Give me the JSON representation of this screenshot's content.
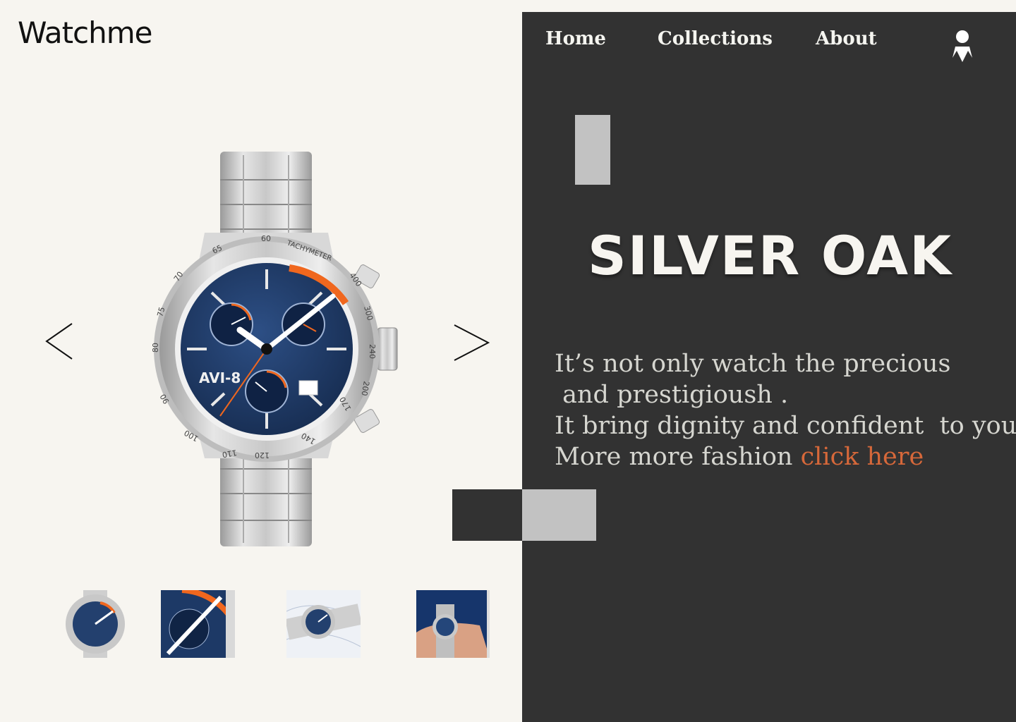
{
  "brand": {
    "logo_text": "Watchme"
  },
  "nav": {
    "items": [
      {
        "label": "Home"
      },
      {
        "label": "Collections"
      },
      {
        "label": "About"
      }
    ],
    "account_icon": "user-icon"
  },
  "hero": {
    "title": "SILVER OAK",
    "description_lines": [
      "It’s not only watch the precious",
      " and prestigioush .",
      "It bring dignity and confident  to you",
      "More more fashion "
    ],
    "link_label": "click here"
  },
  "gallery": {
    "prev_icon": "chevron-left-icon",
    "next_icon": "chevron-right-icon",
    "main_image": "silver-chronograph-watch",
    "watch_dial_text": {
      "brand": "AVI-8",
      "bezel_label": "TACHYMETER",
      "bezel_numbers": [
        "60",
        "65",
        "70",
        "75",
        "80",
        "90",
        "100",
        "110",
        "120",
        "140",
        "170",
        "200",
        "240",
        "300",
        "400"
      ]
    },
    "thumbnails": [
      {
        "name": "full-watch"
      },
      {
        "name": "dial-closeup"
      },
      {
        "name": "watch-on-map"
      },
      {
        "name": "watch-on-wrist"
      }
    ]
  },
  "colors": {
    "background": "#f7f5f0",
    "panel": "#323232",
    "accent": "#d6683a",
    "deco_gray": "#c2c2c2",
    "dial_blue": "#1f3a66",
    "dial_orange": "#f0671e"
  }
}
